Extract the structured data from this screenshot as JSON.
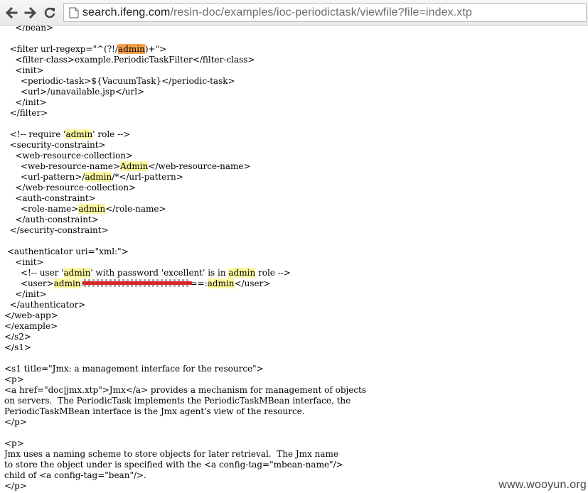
{
  "browser": {
    "url_host": "search.ifeng.com",
    "url_path": "/resin-doc/examples/ioc-periodictask/viewfile?file=index.xtp"
  },
  "lines": [
    [
      "    </bean>"
    ],
    [
      ""
    ],
    [
      "  <filter url-regexp=\"^(?!/",
      {
        "t": "admin",
        "c": "hl-cur"
      },
      ")+\">"
    ],
    [
      "    <filter-class>example.PeriodicTaskFilter</filter-class>"
    ],
    [
      "    <init>"
    ],
    [
      "      <periodic-task>${VacuumTask}</periodic-task>"
    ],
    [
      "      <url>/unavailable.jsp</url>"
    ],
    [
      "    </init>"
    ],
    [
      "  </filter>"
    ],
    [
      ""
    ],
    [
      "  <!-- require '",
      {
        "t": "admin",
        "c": "hl"
      },
      "' role -->"
    ],
    [
      "  <security-constraint>"
    ],
    [
      "    <web-resource-collection>"
    ],
    [
      "      <web-resource-name>",
      {
        "t": "Admin",
        "c": "hl"
      },
      "</web-resource-name>"
    ],
    [
      "      <url-pattern>/",
      {
        "t": "admin",
        "c": "hl"
      },
      "/*</url-pattern>"
    ],
    [
      "    </web-resource-collection>"
    ],
    [
      "    <auth-constraint>"
    ],
    [
      "      <role-name>",
      {
        "t": "admin",
        "c": "hl"
      },
      "</role-name>"
    ],
    [
      "    </auth-constraint>"
    ],
    [
      "  </security-constraint>"
    ],
    [
      ""
    ],
    [
      " <authenticator uri=\"xml:\">"
    ],
    [
      "    <init>"
    ],
    [
      "      <!-- user '",
      {
        "t": "admin",
        "c": "hl"
      },
      "' with password 'excellent' is in ",
      {
        "t": "admin",
        "c": "hl"
      },
      " role -->"
    ],
    [
      "      <user>",
      {
        "t": "admin",
        "c": "hl"
      },
      ":",
      {
        "redact": true
      },
      "==:",
      {
        "t": "admin",
        "c": "hl"
      },
      "</user>"
    ],
    [
      "    </init>"
    ],
    [
      "  </authenticator>"
    ],
    [
      "</web-app>"
    ],
    [
      "</example>"
    ],
    [
      "</s2>"
    ],
    [
      "</s1>"
    ],
    [
      ""
    ],
    [
      "<s1 title=\"Jmx: a management interface for the resource\">"
    ],
    [
      "<p>"
    ],
    [
      "<a href=\"doc|jmx.xtp\">Jmx</a> provides a mechanism for management of objects"
    ],
    [
      "on servers.  The PeriodicTask implements the PeriodicTaskMBean interface, the"
    ],
    [
      "PeriodicTaskMBean interface is the Jmx agent's view of the resource."
    ],
    [
      "</p>"
    ],
    [
      ""
    ],
    [
      "<p>"
    ],
    [
      "Jmx uses a naming scheme to store objects for later retrieval.  The Jmx name"
    ],
    [
      "to store the object under is specified with the <a config-tag=\"mbean-name\"/>"
    ],
    [
      "child of <a config-tag=\"bean\"/>."
    ],
    [
      "</p>"
    ]
  ],
  "watermark": "www.wooyun.org"
}
